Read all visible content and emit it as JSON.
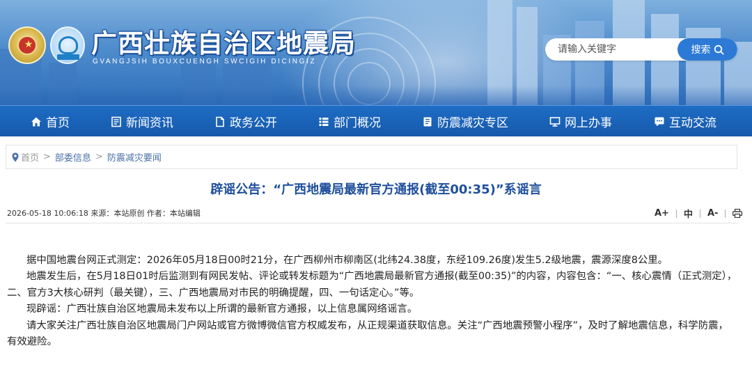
{
  "header": {
    "title": "广西壮族自治区地震局",
    "subtitle": "GVANGJSIH BOUXCUENGH SWCIGIH DICINGIZ"
  },
  "search": {
    "placeholder": "请输入关键字",
    "button_label": "搜索"
  },
  "nav": {
    "items": [
      {
        "label": "首页",
        "icon": "home-icon"
      },
      {
        "label": "新闻资讯",
        "icon": "news-icon"
      },
      {
        "label": "政务公开",
        "icon": "document-icon"
      },
      {
        "label": "部门概况",
        "icon": "list-icon"
      },
      {
        "label": "防震减灾专区",
        "icon": "book-icon"
      },
      {
        "label": "网上办事",
        "icon": "monitor-icon"
      },
      {
        "label": "互动交流",
        "icon": "chat-icon"
      }
    ]
  },
  "breadcrumb": {
    "home": "首页",
    "items": [
      "部委信息",
      "防震减灾要闻"
    ],
    "separator": ">"
  },
  "article": {
    "title": "辟谣公告：“广西地震局最新官方通报(截至00:35)”系谣言",
    "meta": "2026-05-18 10:06:18 来源：本站原创 作者：本站编辑",
    "tools": {
      "font_larger": "A+",
      "font_medium": "中",
      "font_smaller": "A-"
    },
    "paragraphs": [
      "据中国地震台网正式测定：2026年05月18日00时21分，在广西柳州市柳南区(北纬24.38度，东经109.26度)发生5.2级地震，震源深度8公里。",
      "地震发生后，在5月18日01时后监测到有网民发帖、评论或转发标题为“广西地震局最新官方通报(截至00:35)”的内容，内容包含：“一、核心震情（正式测定），二、官方3大核心研判（最关键），三、广西地震局对市民的明确提醒，四、一句话定心。”等。",
      "现辟谣：广西壮族自治区地震局未发布以上所谓的最新官方通报，以上信息属网络谣言。",
      "请大家关注广西壮族自治区地震局门户网站或官方微博微信官方权威发布，从正规渠道获取信息。关注“广西地震预警小程序”，及时了解地震信息，科学防震，有效避险。"
    ]
  },
  "colors": {
    "nav_bg": "#1a62b8",
    "title_color": "#1f4f9c",
    "search_button": "#2d7ad6"
  }
}
